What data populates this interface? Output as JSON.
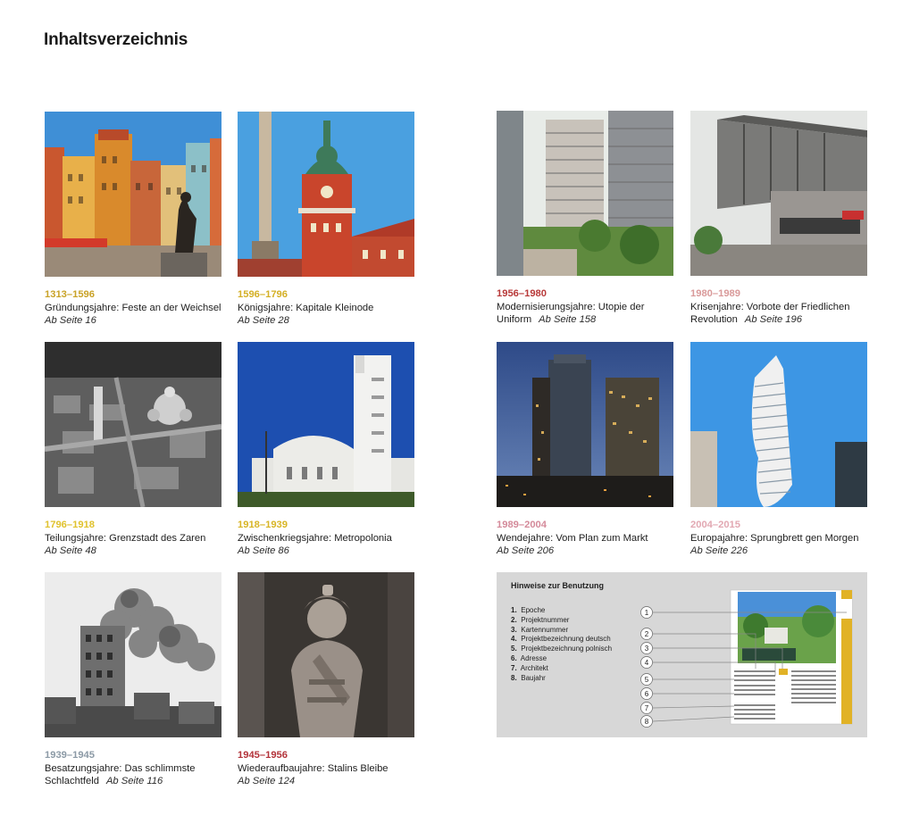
{
  "page": {
    "title": "Inhaltsverzeichnis"
  },
  "entries": [
    {
      "years": "1313–1596",
      "title": "Gründungsjahre: Feste an der Weichsel",
      "page": "Ab Seite 16",
      "color": "#c9a227"
    },
    {
      "years": "1596–1796",
      "title": "Königsjahre: Kapitale Kleinode",
      "page": "Ab Seite 28",
      "color": "#d4b026"
    },
    {
      "years": "1956–1980",
      "title": "Modernisierungsjahre: Utopie der",
      "title2": "Uniform",
      "page": "Ab Seite 158",
      "color": "#b83a3a"
    },
    {
      "years": "1980–1989",
      "title": "Krisenjahre: Vorbote der Friedlichen",
      "title2": "Revolution",
      "page": "Ab Seite 196",
      "color": "#d99a9a"
    },
    {
      "years": "1796–1918",
      "title": "Teilungsjahre: Grenzstadt des Zaren",
      "page": "Ab Seite 48",
      "color": "#e0c22e"
    },
    {
      "years": "1918–1939",
      "title": "Zwischenkriegsjahre: Metropolonia",
      "page": "Ab Seite 86",
      "color": "#d8b526"
    },
    {
      "years": "1989–2004",
      "title": "Wendejahre: Vom Plan zum Markt",
      "page": "Ab Seite 206",
      "color": "#d48a9a"
    },
    {
      "years": "2004–2015",
      "title": "Europajahre: Sprungbrett gen Morgen",
      "page": "Ab Seite 226",
      "color": "#e2a8b2"
    },
    {
      "years": "1939–1945",
      "title": "Besatzungsjahre: Das schlimmste",
      "title2": "Schlachtfeld",
      "page": "Ab Seite 116",
      "color": "#8c9aa6"
    },
    {
      "years": "1945–1956",
      "title": "Wiederaufbaujahre: Stalins Bleibe",
      "page": "Ab Seite 124",
      "color": "#b3333a"
    }
  ],
  "hints": {
    "title": "Hinweise zur Benutzung",
    "items": [
      {
        "num": "1.",
        "label": "Epoche"
      },
      {
        "num": "2.",
        "label": "Projektnummer"
      },
      {
        "num": "3.",
        "label": "Kartennummer"
      },
      {
        "num": "4.",
        "label": "Projektbezeichnung deutsch"
      },
      {
        "num": "5.",
        "label": "Projektbezeichnung polnisch"
      },
      {
        "num": "6.",
        "label": "Adresse"
      },
      {
        "num": "7.",
        "label": "Architekt"
      },
      {
        "num": "8.",
        "label": "Baujahr"
      }
    ],
    "callouts": [
      "1",
      "2",
      "3",
      "4",
      "5",
      "6",
      "7",
      "8"
    ]
  }
}
